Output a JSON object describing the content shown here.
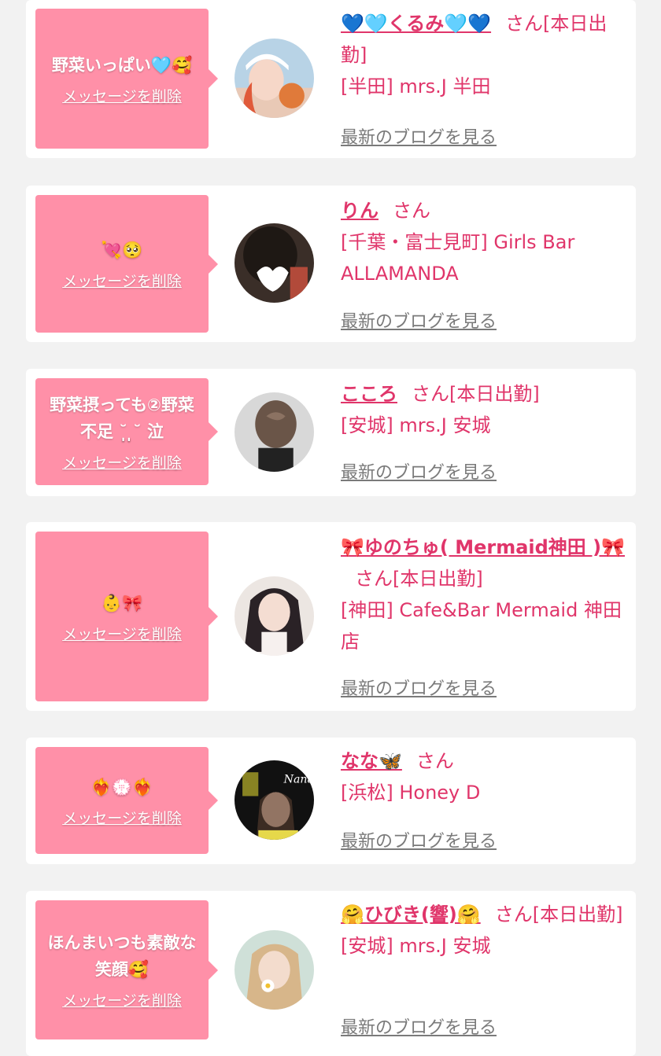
{
  "messages": [
    {
      "message": "野菜いっぱい🩵🥰",
      "delete_label": "メッセージを削除",
      "name": "💙🩵くるみ🩵💙",
      "suffix": "さん[本日出勤]",
      "shop": "[半田] mrs.J 半田",
      "blog_label": "最新のブログを見る"
    },
    {
      "message": "💘🥺",
      "delete_label": "メッセージを削除",
      "name": "りん",
      "suffix": "さん",
      "shop": "[千葉・富士見町] Girls Bar ALLAMANDA",
      "blog_label": "最新のブログを見る"
    },
    {
      "message": "野菜摂っても②野菜不足 ˘̩̩̩ ̩̩̩˘ 泣",
      "delete_label": "メッセージを削除",
      "name": "こころ",
      "suffix": "さん[本日出勤]",
      "shop": "[安城] mrs.J 安城",
      "blog_label": "最新のブログを見る"
    },
    {
      "message": "👶🎀",
      "delete_label": "メッセージを削除",
      "name": "🎀ゆのちゅ( Mermaid神田 )🎀",
      "suffix": "さん[本日出勤]",
      "shop": "[神田] Cafe&Bar Mermaid 神田店",
      "blog_label": "最新のブログを見る"
    },
    {
      "message": "❤️‍🔥💮❤️‍🔥",
      "delete_label": "メッセージを削除",
      "name": "なな🦋",
      "suffix": "さん",
      "shop": "[浜松] Honey D",
      "blog_label": "最新のブログを見る"
    },
    {
      "message": "ほんまいつも素敵な笑顔🥰",
      "delete_label": "メッセージを削除",
      "name": "🤗ひびき(響)🤗",
      "suffix": "さん[本日出勤]",
      "shop": "[安城] mrs.J 安城",
      "blog_label": "最新のブログを見る"
    }
  ],
  "avatar_text": "Nana",
  "colors": {
    "page_bg": "#f2f2f2",
    "card_bg": "#ffffff",
    "bubble_bg": "#ff90a8",
    "accent": "#e0356a",
    "link_gray": "#7a7a7a"
  }
}
